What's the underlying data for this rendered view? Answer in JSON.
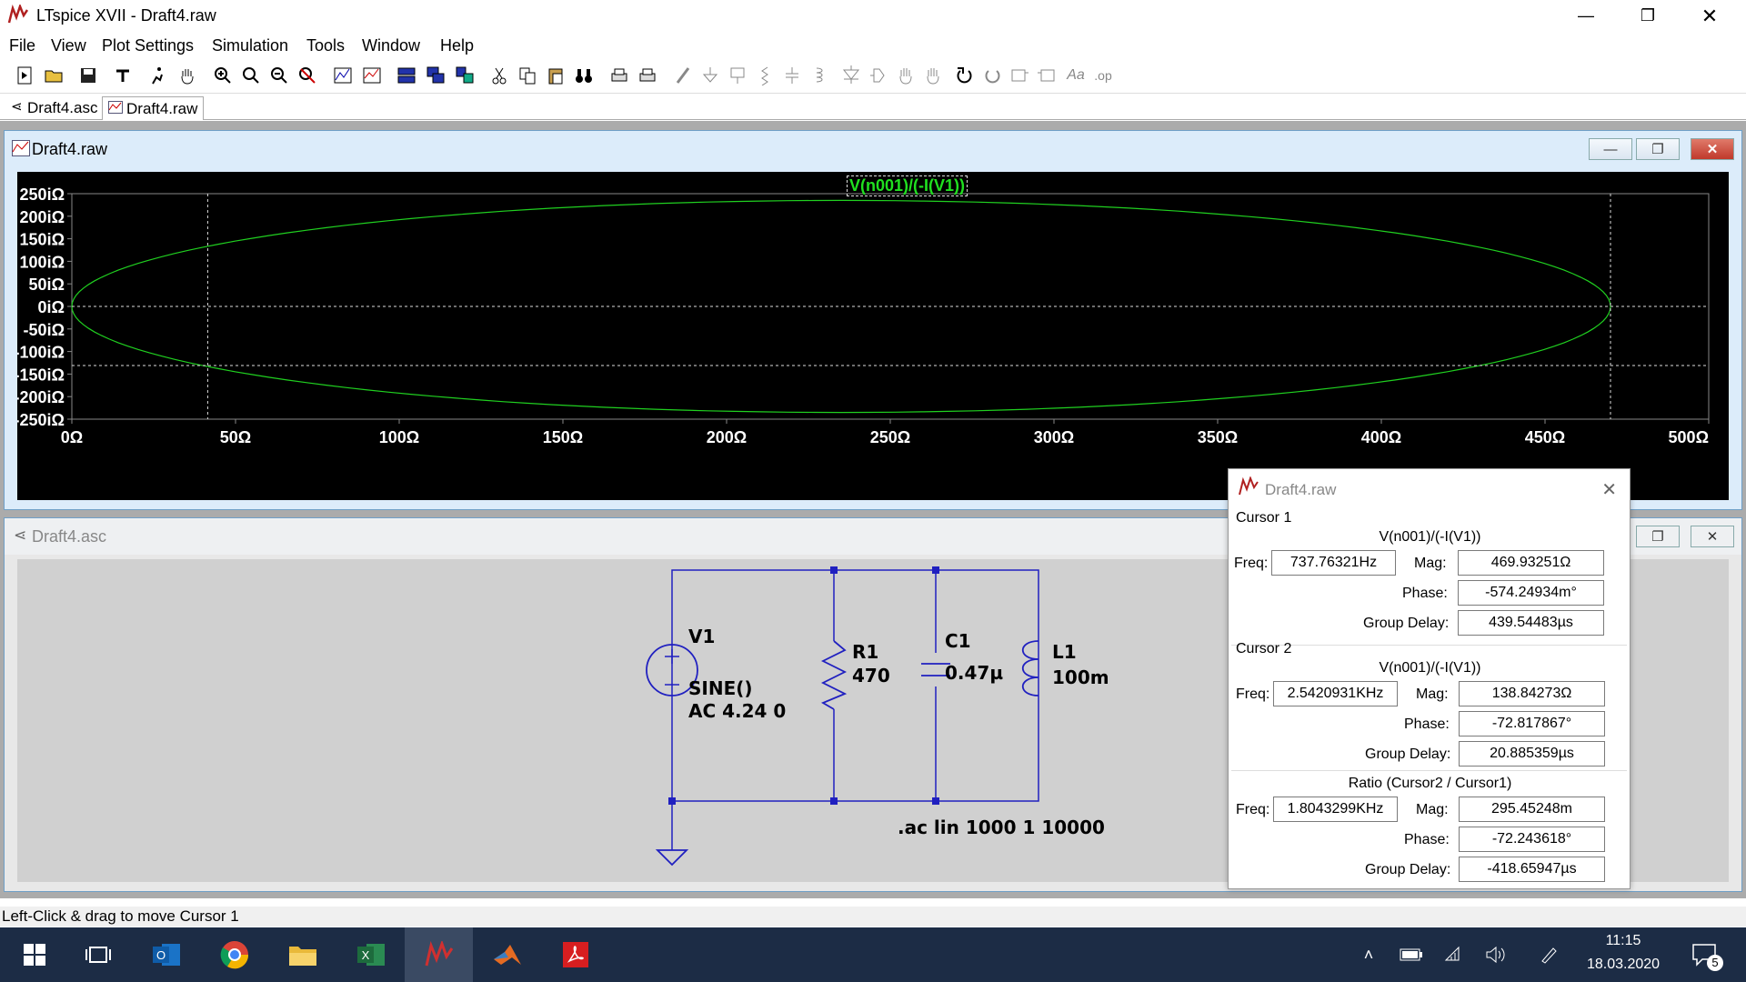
{
  "window": {
    "title": "LTspice XVII - Draft4.raw"
  },
  "menu": [
    "File",
    "View",
    "Plot Settings",
    "Simulation",
    "Tools",
    "Window",
    "Help"
  ],
  "tabs": [
    {
      "label": "Draft4.asc"
    },
    {
      "label": "Draft4.raw"
    }
  ],
  "plot_window": {
    "title": "Draft4.raw"
  },
  "schematic_window": {
    "title": "Draft4.asc"
  },
  "chart_data": {
    "type": "line",
    "title": "V(n001)/(-I(V1))",
    "xlabel": "",
    "ylabel": "",
    "xlim": [
      0,
      500
    ],
    "ylim": [
      -250,
      250
    ],
    "x_ticks": [
      "0Ω",
      "50Ω",
      "100Ω",
      "150Ω",
      "200Ω",
      "250Ω",
      "300Ω",
      "350Ω",
      "400Ω",
      "450Ω",
      "500Ω"
    ],
    "y_ticks": [
      "250iΩ",
      "200iΩ",
      "150iΩ",
      "100iΩ",
      "50iΩ",
      "0iΩ",
      "-50iΩ",
      "-100iΩ",
      "-150iΩ",
      "-200iΩ",
      "-250iΩ"
    ],
    "series": [
      {
        "name": "V(n001)/(-I(V1))",
        "color": "#20d020",
        "shape": "circle",
        "center": [
          235,
          0
        ],
        "radius": 235
      }
    ],
    "cursors": [
      {
        "x": 41.5,
        "y": -131
      },
      {
        "x": 470,
        "y": 0
      }
    ],
    "grid": false
  },
  "schematic": {
    "v1": {
      "name": "V1",
      "value1": "SINE()",
      "value2": "AC 4.24 0"
    },
    "r1": {
      "name": "R1",
      "value": "470"
    },
    "c1": {
      "name": "C1",
      "value": "0.47µ"
    },
    "l1": {
      "name": "L1",
      "value": "100m"
    },
    "directive": ".ac lin 1000 1 10000"
  },
  "cursor_popup": {
    "title": "Draft4.raw",
    "labels": {
      "freq": "Freq:",
      "mag": "Mag:",
      "phase": "Phase:",
      "group_delay": "Group Delay:"
    },
    "cursor1": {
      "header": "Cursor 1",
      "expr": "V(n001)/(-I(V1))",
      "freq": "737.76321Hz",
      "mag": "469.93251Ω",
      "phase": "-574.24934m°",
      "group_delay": "439.54483µs"
    },
    "cursor2": {
      "header": "Cursor 2",
      "expr": "V(n001)/(-I(V1))",
      "freq": "2.5420931KHz",
      "mag": "138.84273Ω",
      "phase": "-72.817867°",
      "group_delay": "20.885359µs"
    },
    "ratio": {
      "header": "Ratio (Cursor2 / Cursor1)",
      "freq": "1.8043299KHz",
      "mag": "295.45248m",
      "phase": "-72.243618°",
      "group_delay": "-418.65947µs"
    }
  },
  "status": {
    "text": "Left-Click & drag to move Cursor 1"
  },
  "taskbar": {
    "time": "11:15",
    "date": "18.03.2020",
    "notifications": "5"
  }
}
